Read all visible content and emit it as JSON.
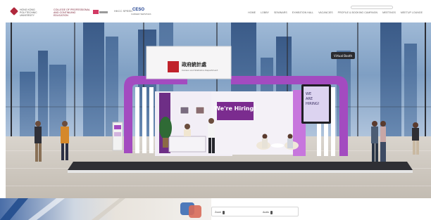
{
  "header": {
    "logos": {
      "hk_text": "HONG KONG POLYTECHNIC UNIVERSITY",
      "college_text": "COLLEGE OF PROFESSIONAL AND CONTINUING EDUCATION",
      "b_text": "HKCC SPEED",
      "ceso": "CESO",
      "ceso_sub": "CAREER SERVICES"
    },
    "nav": [
      "HOME",
      "LOBBY",
      "SEMINARS",
      "EXHIBITION HALL",
      "VACANCIES",
      "PROFILE & BOOKING CAMPAIGN",
      "MEETINGS",
      "MEETUP LOUNGE"
    ]
  },
  "booth": {
    "sign_chinese": "政府統計處",
    "sign_english": "Census and Statistics Department",
    "hiring_banner": "We're Hiring!",
    "screen_text_lines": [
      "WE",
      "ARE",
      "HIRING!"
    ],
    "kiosk_button": "Virtual Booth"
  },
  "bottom": {
    "left_control": "Zoom",
    "right_control": "Audio"
  },
  "colors": {
    "booth_purple": "#a34bc0",
    "booth_white": "#f4f1f7",
    "hiring_bg": "#7b2c8f",
    "brand_red": "#c0232b"
  }
}
